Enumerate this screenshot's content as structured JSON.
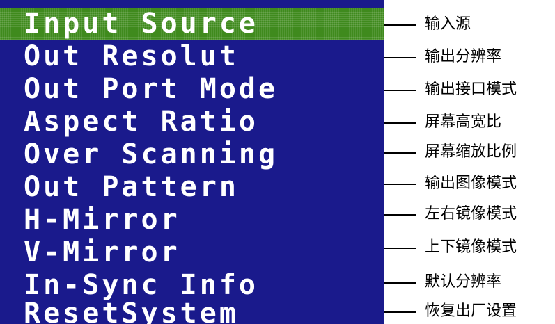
{
  "menu": {
    "selected_index": 0,
    "colors": {
      "background": "#1a1a8c",
      "selected": "#3f8a1d",
      "text": "#ffffff",
      "annotation": "#000000"
    },
    "items": [
      {
        "label": "Input Source",
        "annotation": "输入源"
      },
      {
        "label": "Out Resolut",
        "annotation": "输出分辨率"
      },
      {
        "label": "Out Port Mode",
        "annotation": "输出接口模式"
      },
      {
        "label": "Aspect Ratio",
        "annotation": "屏幕高宽比"
      },
      {
        "label": "Over Scanning",
        "annotation": "屏幕缩放比例"
      },
      {
        "label": "Out Pattern",
        "annotation": "输出图像模式"
      },
      {
        "label": "H-Mirror",
        "annotation": "左右镜像模式"
      },
      {
        "label": "V-Mirror",
        "annotation": "上下镜像模式"
      },
      {
        "label": "In-Sync Info",
        "annotation": "默认分辨率"
      },
      {
        "label": "ResetSystem",
        "annotation": "恢复出厂设置"
      }
    ]
  }
}
